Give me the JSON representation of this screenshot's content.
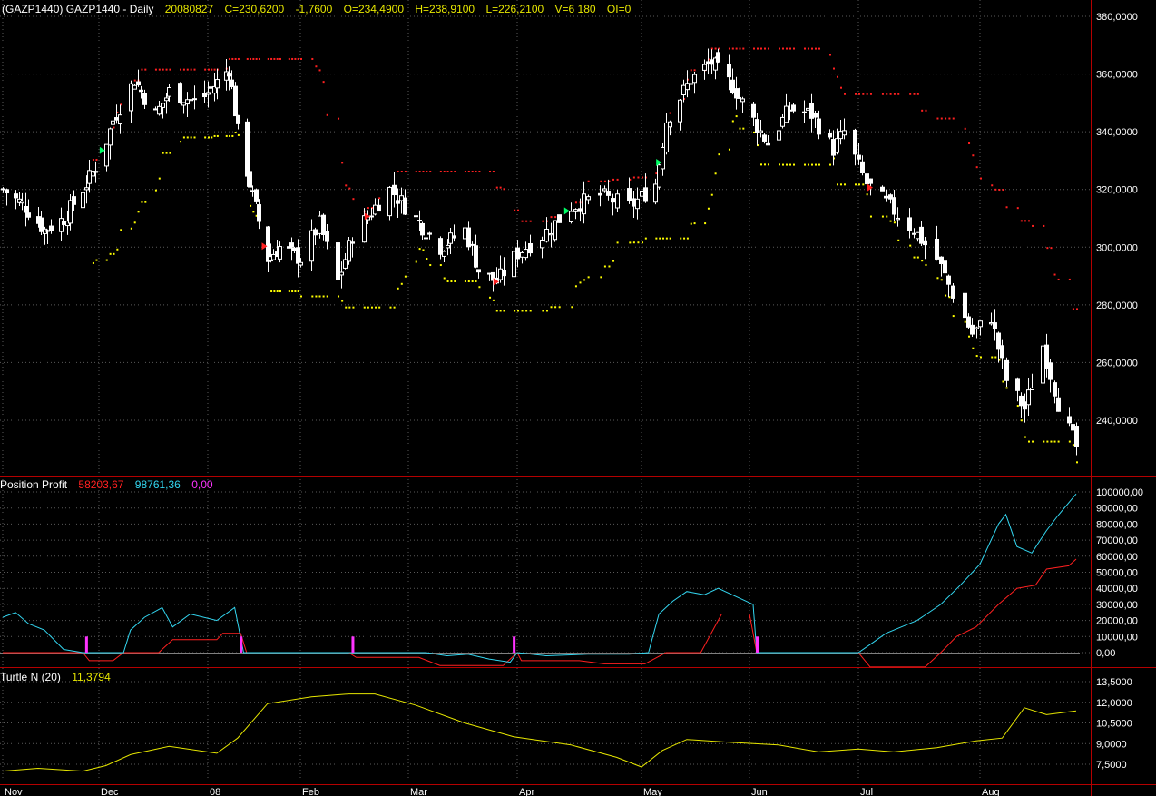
{
  "colors": {
    "background": "#000000",
    "grid": "#5a5a5a",
    "separator": "#b40000",
    "candle": "#ffffff",
    "header_value": "#e6e600",
    "channel_high": "#ff2020",
    "channel_low": "#ffff00",
    "profit_open": "#ff2020",
    "profit_closed": "#33d6f0",
    "profit_zero": "#ff33ff",
    "turtle_n": "#e6e600",
    "entry_long": "#00ff66",
    "entry_short": "#ff2020"
  },
  "price_panel": {
    "header": {
      "name": "(GAZP1440) GAZP1440 - Daily",
      "date": "20080827",
      "close": "C=230,6200",
      "change": "-1,7600",
      "open": "O=234,4900",
      "high": "H=238,9100",
      "low": "L=226,2100",
      "volume": "V=6 180",
      "oi": "OI=0"
    },
    "y_ticks": [
      "380,0000",
      "360,0000",
      "340,0000",
      "320,0000",
      "300,0000",
      "280,0000",
      "260,0000",
      "240,0000"
    ]
  },
  "profit_panel": {
    "header": {
      "name": "Position Profit",
      "v1": "58203,67",
      "v2": "98761,36",
      "v3": "0,00"
    },
    "y_ticks": [
      "100000,00",
      "90000,00",
      "80000,00",
      "70000,00",
      "60000,00",
      "50000,00",
      "40000,00",
      "30000,00",
      "20000,00",
      "10000,00",
      "0,00"
    ]
  },
  "turtle_panel": {
    "header": {
      "name": "Turtle N (20)",
      "value": "11,3794"
    },
    "y_ticks": [
      "13,5000",
      "12,0000",
      "10,5000",
      "9,0000",
      "7,5000"
    ]
  },
  "x_axis": {
    "labels": [
      "Nov",
      "Dec",
      "08",
      "Feb",
      "Mar",
      "Apr",
      "May",
      "Jun",
      "Jul",
      "Aug"
    ]
  },
  "chart_data": [
    {
      "type": "candlestick",
      "ylim": [
        220,
        382
      ],
      "series": [
        {
          "name": "GAZP1440",
          "close_anchors": [
            [
              "2007-11-01",
              320
            ],
            [
              "2007-11-08",
              314
            ],
            [
              "2007-11-14",
              306
            ],
            [
              "2007-11-20",
              310
            ],
            [
              "2007-11-27",
              322
            ],
            [
              "2007-12-01",
              330
            ],
            [
              "2007-12-05",
              344
            ],
            [
              "2007-12-11",
              358
            ],
            [
              "2007-12-17",
              346
            ],
            [
              "2007-12-21",
              354
            ],
            [
              "2007-12-29",
              350
            ],
            [
              "2008-01-08",
              362
            ],
            [
              "2008-01-11",
              340
            ],
            [
              "2008-01-15",
              322
            ],
            [
              "2008-01-21",
              296
            ],
            [
              "2008-01-25",
              300
            ],
            [
              "2008-02-01",
              296
            ],
            [
              "2008-02-06",
              308
            ],
            [
              "2008-02-11",
              288
            ],
            [
              "2008-02-15",
              304
            ],
            [
              "2008-02-21",
              314
            ],
            [
              "2008-02-25",
              320
            ],
            [
              "2008-03-03",
              310
            ],
            [
              "2008-03-10",
              300
            ],
            [
              "2008-03-17",
              306
            ],
            [
              "2008-03-21",
              292
            ],
            [
              "2008-03-26",
              288
            ],
            [
              "2008-04-01",
              298
            ],
            [
              "2008-04-07",
              304
            ],
            [
              "2008-04-14",
              314
            ],
            [
              "2008-04-21",
              318
            ],
            [
              "2008-04-28",
              314
            ],
            [
              "2008-05-05",
              322
            ],
            [
              "2008-05-08",
              344
            ],
            [
              "2008-05-15",
              358
            ],
            [
              "2008-05-21",
              364
            ],
            [
              "2008-05-27",
              356
            ],
            [
              "2008-06-02",
              344
            ],
            [
              "2008-06-06",
              336
            ],
            [
              "2008-06-12",
              348
            ],
            [
              "2008-06-18",
              346
            ],
            [
              "2008-06-24",
              334
            ],
            [
              "2008-06-27",
              340
            ],
            [
              "2008-07-03",
              322
            ],
            [
              "2008-07-09",
              314
            ],
            [
              "2008-07-15",
              306
            ],
            [
              "2008-07-21",
              296
            ],
            [
              "2008-07-25",
              284
            ],
            [
              "2008-07-30",
              270
            ],
            [
              "2008-08-04",
              276
            ],
            [
              "2008-08-08",
              254
            ],
            [
              "2008-08-13",
              244
            ],
            [
              "2008-08-18",
              266
            ],
            [
              "2008-08-22",
              246
            ],
            [
              "2008-08-27",
              230.62
            ]
          ]
        }
      ]
    },
    {
      "type": "line",
      "ylim": [
        -10000,
        103000
      ],
      "series": [
        {
          "name": "Position Profit",
          "color": "#ff2020",
          "points": [
            [
              "2007-11-01",
              0
            ],
            [
              "2007-11-26",
              0
            ],
            [
              "2007-11-28",
              -5000
            ],
            [
              "2007-12-05",
              -5000
            ],
            [
              "2007-12-08",
              0
            ],
            [
              "2007-12-18",
              0
            ],
            [
              "2007-12-22",
              8000
            ],
            [
              "2008-01-04",
              8000
            ],
            [
              "2008-01-06",
              12000
            ],
            [
              "2008-01-12",
              12000
            ],
            [
              "2008-01-14",
              0
            ],
            [
              "2008-02-14",
              0
            ],
            [
              "2008-02-16",
              -3000
            ],
            [
              "2008-03-04",
              -3000
            ],
            [
              "2008-03-10",
              -8000
            ],
            [
              "2008-03-28",
              -8000
            ],
            [
              "2008-04-01",
              0
            ],
            [
              "2008-04-02",
              -5000
            ],
            [
              "2008-04-16",
              -5000
            ],
            [
              "2008-04-22",
              -7000
            ],
            [
              "2008-05-02",
              -7000
            ],
            [
              "2008-05-08",
              0
            ],
            [
              "2008-05-18",
              0
            ],
            [
              "2008-05-24",
              24000
            ],
            [
              "2008-06-01",
              24000
            ],
            [
              "2008-06-03",
              0
            ],
            [
              "2008-07-01",
              0
            ],
            [
              "2008-07-04",
              -9000
            ],
            [
              "2008-07-18",
              -9000
            ],
            [
              "2008-07-22",
              0
            ],
            [
              "2008-07-26",
              10000
            ],
            [
              "2008-07-31",
              16000
            ],
            [
              "2008-08-06",
              30000
            ],
            [
              "2008-08-11",
              40000
            ],
            [
              "2008-08-16",
              42000
            ],
            [
              "2008-08-19",
              52000
            ],
            [
              "2008-08-25",
              54000
            ],
            [
              "2008-08-27",
              58203.67
            ]
          ]
        },
        {
          "name": "",
          "color": "#33d6f0",
          "points": [
            [
              "2007-11-01",
              22000
            ],
            [
              "2007-11-05",
              25000
            ],
            [
              "2007-11-09",
              18000
            ],
            [
              "2007-11-14",
              14000
            ],
            [
              "2007-11-20",
              2000
            ],
            [
              "2007-11-26",
              0
            ],
            [
              "2007-12-08",
              0
            ],
            [
              "2007-12-10",
              14000
            ],
            [
              "2007-12-14",
              22000
            ],
            [
              "2007-12-19",
              28000
            ],
            [
              "2007-12-22",
              16000
            ],
            [
              "2007-12-27",
              24000
            ],
            [
              "2008-01-04",
              20000
            ],
            [
              "2008-01-10",
              28000
            ],
            [
              "2008-01-13",
              0
            ],
            [
              "2008-02-14",
              0
            ],
            [
              "2008-03-06",
              0
            ],
            [
              "2008-03-12",
              -2000
            ],
            [
              "2008-03-18",
              -1000
            ],
            [
              "2008-03-24",
              -4000
            ],
            [
              "2008-03-30",
              -6000
            ],
            [
              "2008-04-01",
              0
            ],
            [
              "2008-04-08",
              -2000
            ],
            [
              "2008-04-18",
              -1000
            ],
            [
              "2008-04-28",
              -1000
            ],
            [
              "2008-05-03",
              0
            ],
            [
              "2008-05-06",
              24000
            ],
            [
              "2008-05-10",
              32000
            ],
            [
              "2008-05-14",
              38000
            ],
            [
              "2008-05-19",
              36000
            ],
            [
              "2008-05-23",
              40000
            ],
            [
              "2008-05-29",
              34000
            ],
            [
              "2008-06-02",
              30000
            ],
            [
              "2008-06-03",
              0
            ],
            [
              "2008-07-01",
              0
            ],
            [
              "2008-07-04",
              5000
            ],
            [
              "2008-07-08",
              12000
            ],
            [
              "2008-07-12",
              16000
            ],
            [
              "2008-07-16",
              20000
            ],
            [
              "2008-07-22",
              30000
            ],
            [
              "2008-07-27",
              42000
            ],
            [
              "2008-08-01",
              55000
            ],
            [
              "2008-08-06",
              80000
            ],
            [
              "2008-08-08",
              86000
            ],
            [
              "2008-08-11",
              66000
            ],
            [
              "2008-08-15",
              62000
            ],
            [
              "2008-08-19",
              76000
            ],
            [
              "2008-08-22",
              85000
            ],
            [
              "2008-08-27",
              98761.36
            ]
          ]
        }
      ],
      "markers": [
        "2007-11-27",
        "2008-01-12",
        "2008-02-15",
        "2008-03-31",
        "2008-06-03"
      ]
    },
    {
      "type": "line",
      "ylim": [
        6.5,
        14.5
      ],
      "series": [
        {
          "name": "Turtle N (20)",
          "color": "#e6e600",
          "points": [
            [
              "2007-11-01",
              7.0
            ],
            [
              "2007-11-12",
              7.2
            ],
            [
              "2007-11-26",
              7.0
            ],
            [
              "2007-12-03",
              7.4
            ],
            [
              "2007-12-10",
              8.2
            ],
            [
              "2007-12-21",
              8.8
            ],
            [
              "2008-01-04",
              8.3
            ],
            [
              "2008-01-11",
              9.4
            ],
            [
              "2008-01-21",
              11.9
            ],
            [
              "2008-02-04",
              12.4
            ],
            [
              "2008-02-14",
              12.6
            ],
            [
              "2008-02-21",
              12.6
            ],
            [
              "2008-03-03",
              11.8
            ],
            [
              "2008-03-17",
              10.5
            ],
            [
              "2008-03-31",
              9.5
            ],
            [
              "2008-04-14",
              8.9
            ],
            [
              "2008-04-25",
              8.0
            ],
            [
              "2008-05-01",
              7.3
            ],
            [
              "2008-05-07",
              8.5
            ],
            [
              "2008-05-14",
              9.3
            ],
            [
              "2008-05-26",
              9.1
            ],
            [
              "2008-06-09",
              8.9
            ],
            [
              "2008-06-20",
              8.4
            ],
            [
              "2008-07-01",
              8.6
            ],
            [
              "2008-07-10",
              8.4
            ],
            [
              "2008-07-21",
              8.7
            ],
            [
              "2008-07-31",
              9.2
            ],
            [
              "2008-08-07",
              9.4
            ],
            [
              "2008-08-13",
              11.6
            ],
            [
              "2008-08-19",
              11.1
            ],
            [
              "2008-08-27",
              11.3794
            ]
          ]
        }
      ]
    }
  ]
}
